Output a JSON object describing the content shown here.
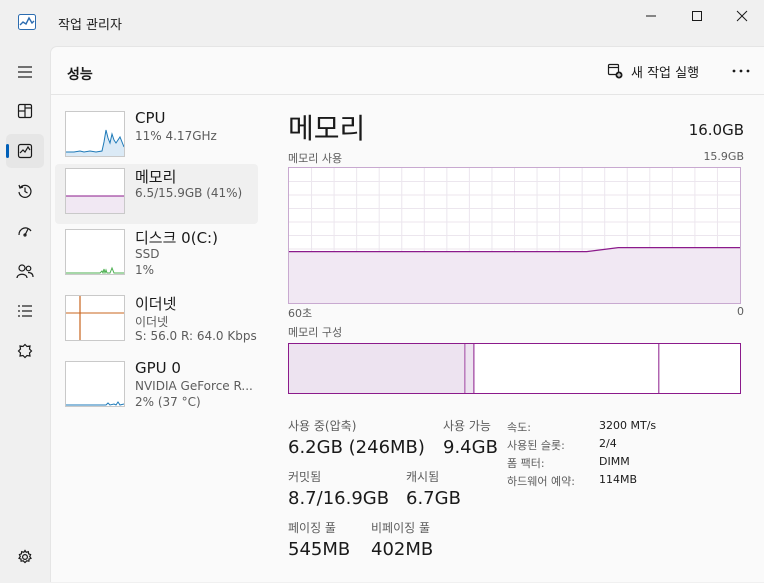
{
  "window": {
    "title": "작업 관리자"
  },
  "header": {
    "title": "성능",
    "new_task_label": "새 작업 실행"
  },
  "nav": {
    "items": [
      {
        "name": "menu-icon"
      },
      {
        "name": "processes-icon"
      },
      {
        "name": "performance-icon"
      },
      {
        "name": "app-history-icon"
      },
      {
        "name": "startup-apps-icon"
      },
      {
        "name": "users-icon"
      },
      {
        "name": "details-icon"
      },
      {
        "name": "services-icon"
      },
      {
        "name": "settings-icon"
      }
    ]
  },
  "sidebar": {
    "items": [
      {
        "name": "CPU",
        "line1": "11%  4.17GHz",
        "line2": ""
      },
      {
        "name": "메모리",
        "line1": "6.5/15.9GB (41%)",
        "line2": ""
      },
      {
        "name": "디스크 0(C:)",
        "line1": "SSD",
        "line2": "1%"
      },
      {
        "name": "이더넷",
        "line1": "이더넷",
        "line2": "S: 56.0  R: 64.0 Kbps"
      },
      {
        "name": "GPU 0",
        "line1": "NVIDIA GeForce R...",
        "line2": "2%  (37 °C)"
      }
    ]
  },
  "memory": {
    "title": "메모리",
    "total": "16.0GB",
    "usage_label": "메모리 사용",
    "usage_max": "15.9GB",
    "axis_left": "60초",
    "axis_right": "0",
    "composition_label": "메모리 구성",
    "composition": {
      "in_use_fraction": 0.39,
      "modified_fraction": 0.02,
      "standby_fraction": 0.41,
      "free_fraction": 0.18
    },
    "usage_fraction": 0.41,
    "stats": {
      "in_use_label": "사용 중(압축)",
      "in_use_value": "6.2GB (246MB)",
      "available_label": "사용 가능",
      "available_value": "9.4GB",
      "committed_label": "커밋됨",
      "committed_value": "8.7/16.9GB",
      "cached_label": "캐시됨",
      "cached_value": "6.7GB",
      "paged_label": "페이징 풀",
      "paged_value": "545MB",
      "nonpaged_label": "비페이징 풀",
      "nonpaged_value": "402MB"
    },
    "specs": [
      {
        "key": "속도:",
        "value": "3200 MT/s"
      },
      {
        "key": "사용된 슬롯:",
        "value": "2/4"
      },
      {
        "key": "폼 팩터:",
        "value": "DIMM"
      },
      {
        "key": "하드웨어 예약:",
        "value": "114MB"
      }
    ]
  },
  "colors": {
    "memory": "#8b1a8b",
    "cpu": "#1e7ab8",
    "disk": "#4caf50",
    "ethernet": "#c8641e",
    "accent": "#005fb8"
  }
}
